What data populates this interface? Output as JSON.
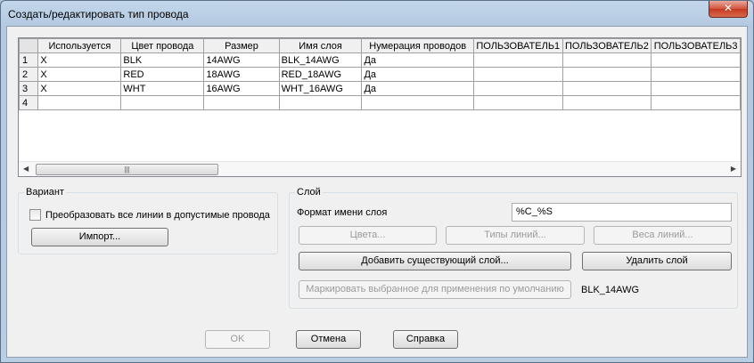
{
  "window": {
    "title": "Создать/редактировать тип провода",
    "close_glyph": "✕"
  },
  "grid": {
    "columns": [
      "Используется",
      "Цвет провода",
      "Размер",
      "Имя слоя",
      "Нумерация проводов",
      "ПОЛЬЗОВАТЕЛЬ1",
      "ПОЛЬЗОВАТЕЛЬ2",
      "ПОЛЬЗОВАТЕЛЬ3"
    ],
    "rows": [
      {
        "num": "1",
        "cells": [
          "X",
          "BLK",
          "14AWG",
          "BLK_14AWG",
          "Да",
          "",
          "",
          ""
        ]
      },
      {
        "num": "2",
        "cells": [
          "X",
          "RED",
          "18AWG",
          "RED_18AWG",
          "Да",
          "",
          "",
          ""
        ]
      },
      {
        "num": "3",
        "cells": [
          "X",
          "WHT",
          "16AWG",
          "WHT_16AWG",
          "Да",
          "",
          "",
          ""
        ]
      },
      {
        "num": "4",
        "cells": [
          "",
          "",
          "",
          "",
          "",
          "",
          "",
          ""
        ]
      }
    ]
  },
  "variant": {
    "label": "Вариант",
    "checkbox_label": "Преобразовать все линии в допустимые провода",
    "checkbox_checked": false,
    "import_button": "Импорт..."
  },
  "layer": {
    "label": "Слой",
    "format_label": "Формат имени слоя",
    "format_value": "%C_%S",
    "colors_button": "Цвета...",
    "linetypes_button": "Типы линий...",
    "lineweights_button": "Веса линий...",
    "add_existing_button": "Добавить существующий слой...",
    "delete_button": "Удалить слой",
    "mark_default_button": "Маркировать выбранное для применения по умолчанию",
    "default_value": "BLK_14AWG"
  },
  "footer": {
    "ok": "OK",
    "cancel": "Отмена",
    "help": "Справка"
  },
  "colors": {
    "close_red": "#c43a20",
    "disabled_text": "#9a9a9a"
  }
}
